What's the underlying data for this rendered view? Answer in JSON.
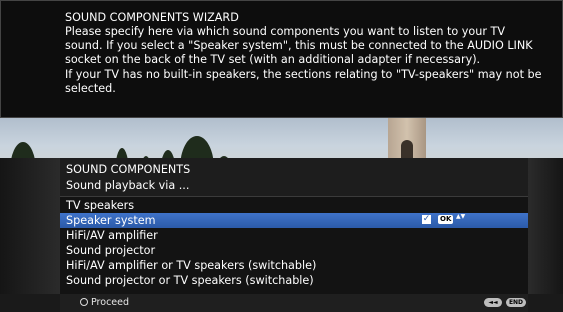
{
  "info": {
    "title": "SOUND COMPONENTS WIZARD",
    "text": "Please specify here via which sound components you want to listen to your TV sound. If you select a \"Speaker system\", this must be connected to the AUDIO LINK socket on the back of the TV set (with an additional adapter if necessary).\nIf your TV has no built-in speakers, the sections relating to \"TV-speakers\" may not be selected."
  },
  "panel": {
    "title": "SOUND COMPONENTS",
    "subtitle": "Sound playback via ..."
  },
  "items": [
    {
      "label": "TV speakers",
      "selected": false
    },
    {
      "label": "Speaker system",
      "selected": true
    },
    {
      "label": "HiFi/AV amplifier",
      "selected": false
    },
    {
      "label": "Sound projector",
      "selected": false
    },
    {
      "label": "HiFi/AV amplifier or TV speakers (switchable)",
      "selected": false
    },
    {
      "label": "Sound projector or TV speakers (switchable)",
      "selected": false
    }
  ],
  "selected_row": {
    "check": "✓",
    "ok": "OK",
    "updown": "▲▼"
  },
  "footer": {
    "proceed": "Proceed",
    "back": "◄◄",
    "end": "END"
  },
  "colors": {
    "highlight": "#3f73c9",
    "panel": "#131313"
  }
}
